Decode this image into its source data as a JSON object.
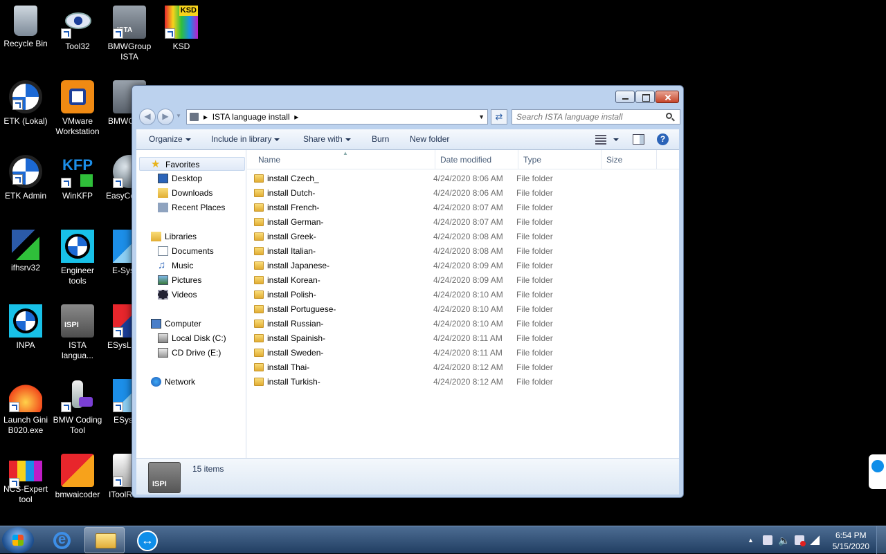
{
  "desktop": {
    "icons": [
      {
        "label": "Recycle Bin"
      },
      {
        "label": "Tool32"
      },
      {
        "label": "BMWGroup ISTA"
      },
      {
        "label": "KSD"
      },
      {
        "label": "ETK (Lokal)"
      },
      {
        "label": "VMware Workstation"
      },
      {
        "label": "BMWG ISTA"
      },
      {
        "label": "ETK Admin"
      },
      {
        "label": "WinKFP"
      },
      {
        "label": "EasyCo"
      },
      {
        "label": "ifhsrv32"
      },
      {
        "label": "Engineer tools"
      },
      {
        "label": "E-Sys"
      },
      {
        "label": "INPA"
      },
      {
        "label": "ISTA langua..."
      },
      {
        "label": "ESysLa"
      },
      {
        "label": "Launch Gini B020.exe"
      },
      {
        "label": "BMW Coding Tool"
      },
      {
        "label": "ESysl"
      },
      {
        "label": "NCS-Expert tool"
      },
      {
        "label": "bmwaicoder"
      },
      {
        "label": "IToolR"
      }
    ],
    "icon_badges": {
      "ksd": "KSD",
      "kfp": "KFP",
      "ista": "ISTA",
      "ispi": "ISPI"
    }
  },
  "window": {
    "address": {
      "crumb": "ISTA language install"
    },
    "search": {
      "placeholder": "Search ISTA language install"
    },
    "toolbar": {
      "organize": "Organize",
      "include_library": "Include in library",
      "share_with": "Share with",
      "burn": "Burn",
      "new_folder": "New folder"
    },
    "nav": {
      "favorites": "Favorites",
      "desktop": "Desktop",
      "downloads": "Downloads",
      "recent_places": "Recent Places",
      "libraries": "Libraries",
      "documents": "Documents",
      "music": "Music",
      "pictures": "Pictures",
      "videos": "Videos",
      "computer": "Computer",
      "local_disk": "Local Disk (C:)",
      "cd_drive": "CD Drive (E:)",
      "network": "Network"
    },
    "columns": {
      "name": "Name",
      "date": "Date modified",
      "type": "Type",
      "size": "Size"
    },
    "files": [
      {
        "name": "install Czech_",
        "date": "4/24/2020 8:06 AM",
        "type": "File folder"
      },
      {
        "name": "install Dutch-",
        "date": "4/24/2020 8:06 AM",
        "type": "File folder"
      },
      {
        "name": "install French-",
        "date": "4/24/2020 8:07 AM",
        "type": "File folder"
      },
      {
        "name": "install German-",
        "date": "4/24/2020 8:07 AM",
        "type": "File folder"
      },
      {
        "name": "install Greek-",
        "date": "4/24/2020 8:08 AM",
        "type": "File folder"
      },
      {
        "name": "install Italian-",
        "date": "4/24/2020 8:08 AM",
        "type": "File folder"
      },
      {
        "name": "install Japanese-",
        "date": "4/24/2020 8:09 AM",
        "type": "File folder"
      },
      {
        "name": "install Korean-",
        "date": "4/24/2020 8:09 AM",
        "type": "File folder"
      },
      {
        "name": "install Polish-",
        "date": "4/24/2020 8:10 AM",
        "type": "File folder"
      },
      {
        "name": "install Portuguese-",
        "date": "4/24/2020 8:10 AM",
        "type": "File folder"
      },
      {
        "name": "install Russian-",
        "date": "4/24/2020 8:10 AM",
        "type": "File folder"
      },
      {
        "name": "install Spainish-",
        "date": "4/24/2020 8:11 AM",
        "type": "File folder"
      },
      {
        "name": "install Sweden-",
        "date": "4/24/2020 8:11 AM",
        "type": "File folder"
      },
      {
        "name": "install Thai-",
        "date": "4/24/2020 8:12 AM",
        "type": "File folder"
      },
      {
        "name": "install Turkish-",
        "date": "4/24/2020 8:12 AM",
        "type": "File folder"
      }
    ],
    "details": {
      "count": "15 items",
      "thumb_label": "ISPI"
    }
  },
  "taskbar": {
    "clock_time": "6:54 PM",
    "clock_date": "5/15/2020"
  },
  "colors": {
    "accent": "#1c5bb8",
    "folder": "#e1ad33",
    "taskbar": "#213e62"
  }
}
